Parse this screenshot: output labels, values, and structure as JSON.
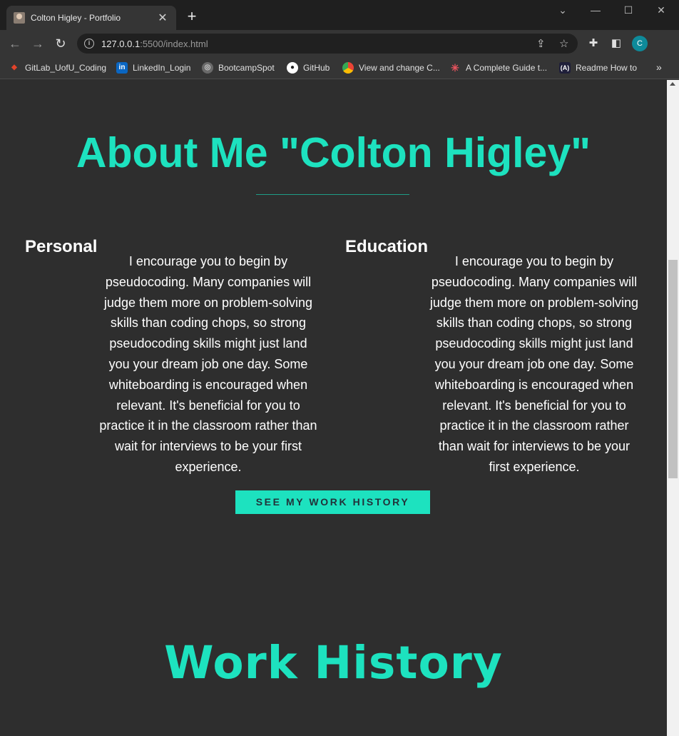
{
  "browser": {
    "tab_title": "Colton Higley - Portfolio",
    "tab_close": "✕",
    "new_tab": "+",
    "window_controls": {
      "dropdown": "⌄",
      "minimize": "—",
      "maximize": "☐",
      "close": "✕"
    },
    "url_host": "127.0.0.1",
    "url_rest": ":5500/index.html",
    "bookmarks": [
      {
        "label": "GitLab_UofU_Coding",
        "icon": "gitlab-icon",
        "color": "#e2432a"
      },
      {
        "label": "LinkedIn_Login",
        "icon": "linkedin-icon",
        "color": "#0a66c2"
      },
      {
        "label": "BootcampSpot",
        "icon": "globe-icon",
        "color": "#9a9a9a"
      },
      {
        "label": "GitHub",
        "icon": "github-icon",
        "color": "#ffffff"
      },
      {
        "label": "View and change C...",
        "icon": "chrome-icon",
        "color": "#f2b400"
      },
      {
        "label": "A Complete Guide t...",
        "icon": "asterisk-icon",
        "color": "#e9535e"
      },
      {
        "label": "Readme How to",
        "icon": "readme-icon",
        "color": "#6c5ce7"
      }
    ],
    "bookmarks_more": "»",
    "profile_initial": "C"
  },
  "about": {
    "title": "About Me \"Colton Higley\"",
    "personal": {
      "heading": "Personal",
      "text": "I encourage you to begin by pseudocoding. Many companies will judge them more on problem-solving skills than coding chops, so strong pseudocoding skills might just land you your dream job one day. Some whiteboarding is encouraged when relevant. It's beneficial for you to practice it in the classroom rather than wait for interviews to be your first experience."
    },
    "education": {
      "heading": "Education",
      "text": "I encourage you to begin by pseudocoding. Many companies will judge them more on problem-solving skills than coding chops, so strong pseudocoding skills might just land you your dream job one day. Some whiteboarding is encouraged when relevant. It's beneficial for you to practice it in the classroom rather than wait for interviews to be your first experience."
    },
    "button_label": "SEE MY WORK HISTORY"
  },
  "work": {
    "title": "Work History"
  },
  "colors": {
    "accent": "#1de2bf",
    "background": "#2e2e2e"
  }
}
